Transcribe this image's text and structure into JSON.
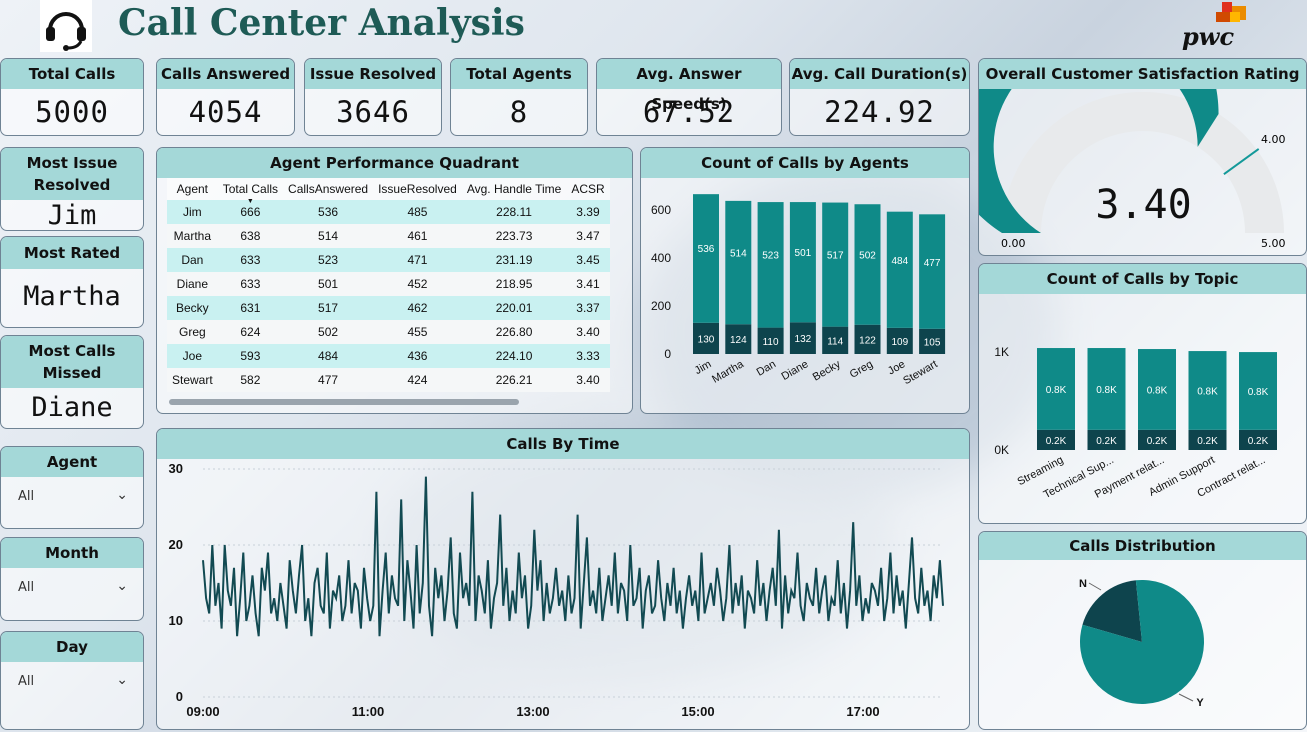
{
  "header": {
    "title": "Call Center Analysis",
    "logo_text": "pwc",
    "headset_icon": "headset-icon"
  },
  "kpis": [
    {
      "label": "Total Calls",
      "value": "5000"
    },
    {
      "label": "Calls Answered",
      "value": "4054"
    },
    {
      "label": "Issue Resolved",
      "value": "3646"
    },
    {
      "label": "Total Agents",
      "value": "8"
    },
    {
      "label": "Avg. Answer Speed(s)",
      "value": "67.52"
    },
    {
      "label": "Avg. Call Duration(s)",
      "value": "224.92"
    }
  ],
  "side": {
    "most_issue_resolved": {
      "label_line1": "Most Issue",
      "label_line2": "Resolved",
      "value": "Jim"
    },
    "most_rated": {
      "label": "Most Rated",
      "value": "Martha"
    },
    "most_calls_missed": {
      "label_line1": "Most Calls",
      "label_line2": "Missed",
      "value": "Diane"
    }
  },
  "slicers": [
    {
      "label": "Agent",
      "value": "All"
    },
    {
      "label": "Month",
      "value": "All"
    },
    {
      "label": "Day",
      "value": "All"
    }
  ],
  "quadrant": {
    "title": "Agent Performance Quadrant",
    "columns": [
      "Agent",
      "Total Calls",
      "CallsAnswered",
      "IssueResolved",
      "Avg. Handle Time",
      "ACSR"
    ],
    "rows": [
      [
        "Jim",
        "666",
        "536",
        "485",
        "228.11",
        "3.39"
      ],
      [
        "Martha",
        "638",
        "514",
        "461",
        "223.73",
        "3.47"
      ],
      [
        "Dan",
        "633",
        "523",
        "471",
        "231.19",
        "3.45"
      ],
      [
        "Diane",
        "633",
        "501",
        "452",
        "218.95",
        "3.41"
      ],
      [
        "Becky",
        "631",
        "517",
        "462",
        "220.01",
        "3.37"
      ],
      [
        "Greg",
        "624",
        "502",
        "455",
        "226.80",
        "3.40"
      ],
      [
        "Joe",
        "593",
        "484",
        "436",
        "224.10",
        "3.33"
      ],
      [
        "Stewart",
        "582",
        "477",
        "424",
        "226.21",
        "3.40"
      ]
    ]
  },
  "satisfaction": {
    "title": "Overall Customer Satisfaction Rating",
    "value": "3.40",
    "min_label": "0.00",
    "max_label": "5.00",
    "target_label": "4.00",
    "value_num": 3.4,
    "target_num": 4.0,
    "max_num": 5.0
  },
  "colors": {
    "teal": "#0f8a88",
    "dark": "#0e444d",
    "light": "#a4d8d8",
    "line": "#124a52"
  },
  "chart_data": [
    {
      "type": "bar",
      "title": "Count of Calls by Agents",
      "categories": [
        "Jim",
        "Martha",
        "Dan",
        "Diane",
        "Becky",
        "Greg",
        "Joe",
        "Stewart"
      ],
      "series": [
        {
          "name": "",
          "values": [
            130,
            124,
            110,
            132,
            114,
            122,
            109,
            105
          ]
        },
        {
          "name": "",
          "values": [
            536,
            514,
            523,
            501,
            517,
            502,
            484,
            477
          ]
        }
      ],
      "stacked": true,
      "yticks": [
        "0",
        "200",
        "400",
        "600"
      ],
      "ylim": [
        0,
        700
      ]
    },
    {
      "type": "bar",
      "title": "Count of Calls by Topic",
      "categories": [
        "Streaming",
        "Technical Sup...",
        "Payment relat...",
        "Admin Support",
        "Contract relat..."
      ],
      "series": [
        {
          "name": "",
          "values": [
            0.2,
            0.2,
            0.2,
            0.2,
            0.2
          ],
          "labels": [
            "0.2K",
            "0.2K",
            "0.2K",
            "0.2K",
            "0.2K"
          ]
        },
        {
          "name": "",
          "values": [
            0.81,
            0.81,
            0.8,
            0.78,
            0.77
          ],
          "labels": [
            "0.8K",
            "0.8K",
            "0.8K",
            "0.8K",
            "0.8K"
          ]
        }
      ],
      "stacked": true,
      "yticks": [
        "0K",
        "1K"
      ],
      "ylim": [
        0,
        1.05
      ]
    },
    {
      "type": "line",
      "title": "Calls By Time",
      "x_ticks": [
        "09:00",
        "11:00",
        "13:00",
        "15:00",
        "17:00"
      ],
      "yticks": [
        "0",
        "10",
        "20",
        "30"
      ],
      "ylim": [
        0,
        30
      ],
      "values": [
        18,
        13,
        11,
        20,
        12,
        15,
        9,
        20,
        14,
        12,
        17,
        8,
        13,
        19,
        10,
        12,
        16,
        11,
        8,
        17,
        14,
        19,
        11,
        13,
        10,
        15,
        12,
        9,
        18,
        14,
        11,
        16,
        20,
        10,
        13,
        8,
        15,
        17,
        12,
        11,
        19,
        9,
        14,
        13,
        16,
        10,
        12,
        18,
        11,
        15,
        14,
        9,
        17,
        13,
        10,
        12,
        27,
        8,
        14,
        19,
        11,
        16,
        13,
        12,
        26,
        10,
        18,
        14,
        9,
        20,
        11,
        15,
        29,
        12,
        8,
        17,
        13,
        16,
        10,
        14,
        21,
        11,
        9,
        19,
        13,
        15,
        12,
        27,
        10,
        16,
        14,
        11,
        18,
        9,
        13,
        15,
        24,
        12,
        17,
        10,
        14,
        11,
        19,
        13,
        16,
        9,
        12,
        22,
        14,
        18,
        10,
        15,
        11,
        13,
        17,
        12,
        14,
        10,
        16,
        11,
        13,
        24,
        9,
        15,
        21,
        12,
        14,
        11,
        17,
        10,
        13,
        16,
        12,
        19,
        11,
        15,
        14,
        10,
        20,
        12,
        13,
        17,
        9,
        14,
        16,
        11,
        12,
        18,
        13,
        10,
        15,
        12,
        17,
        11,
        14,
        9,
        13,
        16,
        12,
        14,
        10,
        19,
        11,
        13,
        15,
        12,
        17,
        14,
        10,
        13,
        20,
        11,
        15,
        12,
        16,
        9,
        14,
        13,
        11,
        18,
        12,
        15,
        10,
        14,
        17,
        12,
        22,
        9,
        16,
        11,
        14,
        13,
        19,
        12,
        10,
        15,
        13,
        12,
        17,
        11,
        14,
        16,
        10,
        13,
        12,
        18,
        11,
        15,
        9,
        14,
        23,
        12,
        16,
        10,
        13,
        11,
        15,
        14,
        12,
        17,
        10,
        13,
        19,
        11,
        16,
        12,
        14,
        9,
        15,
        21,
        13,
        11,
        17,
        12,
        14,
        10,
        16,
        13,
        18,
        12
      ],
      "line_color": "#124a52"
    },
    {
      "type": "pie",
      "title": "Calls Distribution",
      "labels": [
        "N",
        "Y"
      ],
      "values": [
        946,
        4054
      ]
    }
  ]
}
